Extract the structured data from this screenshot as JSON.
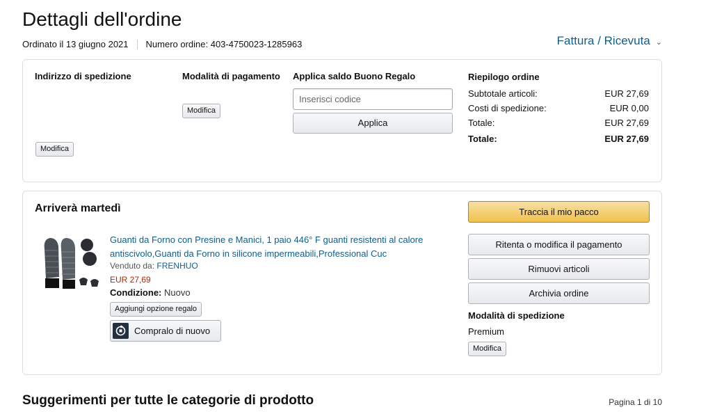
{
  "header": {
    "title": "Dettagli dell'ordine",
    "ordered_on": "Ordinato il 13 giugno 2021",
    "order_number": "Numero ordine: 403-4750023-1285963",
    "invoice_link": "Fattura / Ricevuta"
  },
  "order_info": {
    "shipping_address": {
      "title": "Indirizzo di spedizione",
      "edit_label": "Modifica"
    },
    "payment_method": {
      "title": "Modalità di pagamento",
      "edit_label": "Modifica"
    },
    "gift_card": {
      "title": "Applica saldo Buono Regalo",
      "input_placeholder": "Inserisci codice",
      "apply_label": "Applica"
    },
    "summary": {
      "title": "Riepilogo ordine",
      "rows": [
        {
          "label": "Subtotale articoli:",
          "value": "EUR 27,69"
        },
        {
          "label": "Costi di spedizione:",
          "value": "EUR 0,00"
        },
        {
          "label": "Totale:",
          "value": "EUR 27,69"
        }
      ],
      "grand_total": {
        "label": "Totale:",
        "value": "EUR 27,69"
      }
    }
  },
  "shipment": {
    "arrival": "Arriverà martedì",
    "product": {
      "title": "Guanti da Forno con Presine e Manici, 1 paio 446° F guanti resistenti al calore antiscivolo,Guanti da Forno in silicone impermeabili,Professional Cuc",
      "sold_by_label": "Venduto da:",
      "seller": "FRENHUO",
      "price": "EUR 27,69",
      "condition_label": "Condizione:",
      "condition_value": "Nuovo",
      "gift_option_label": "Aggiungi opzione regalo",
      "buy_again_label": "Compralo di nuovo"
    },
    "actions": {
      "track": "Traccia il mio pacco",
      "retry_payment": "Ritenta o modifica il pagamento",
      "remove_items": "Rimuovi articoli",
      "archive": "Archivia ordine"
    },
    "shipping_method": {
      "title": "Modalità di spedizione",
      "value": "Premium",
      "edit_label": "Modifica"
    }
  },
  "suggestions": {
    "title": "Suggerimenti per tutte le categorie di prodotto",
    "pagination": "Pagina 1 di 10"
  },
  "colors": {
    "link": "#0f5e8a",
    "price": "#b12704",
    "primary_button": "#f0c14b"
  }
}
